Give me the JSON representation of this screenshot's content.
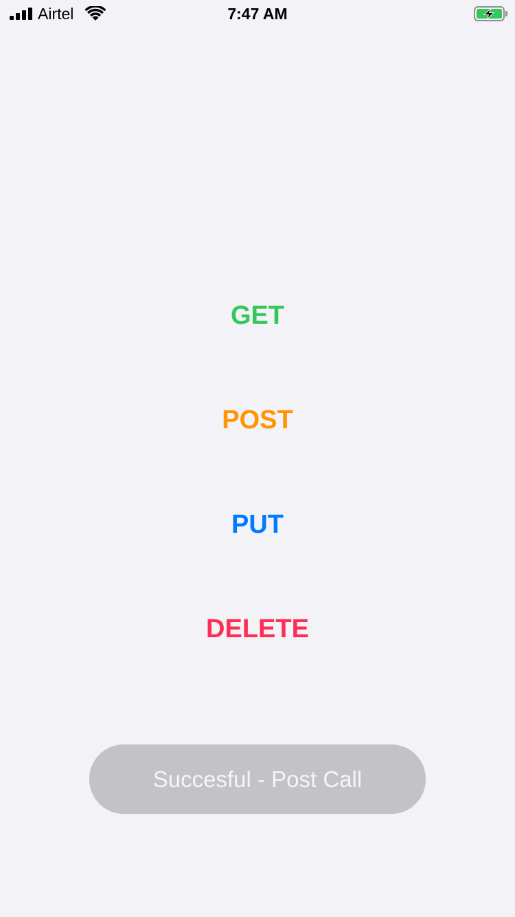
{
  "status_bar": {
    "carrier": "Airtel",
    "time": "7:47 AM",
    "icons": [
      "signal-bars-icon",
      "wifi-icon",
      "battery-charging-icon"
    ]
  },
  "methods": {
    "get": {
      "label": "GET",
      "color": "#34c759"
    },
    "post": {
      "label": "POST",
      "color": "#ff9500"
    },
    "put": {
      "label": "PUT",
      "color": "#007aff"
    },
    "delete": {
      "label": "DELETE",
      "color": "#ff2d55"
    }
  },
  "result": {
    "message": "Succesful - Post Call",
    "background": "#c2c2c7"
  }
}
